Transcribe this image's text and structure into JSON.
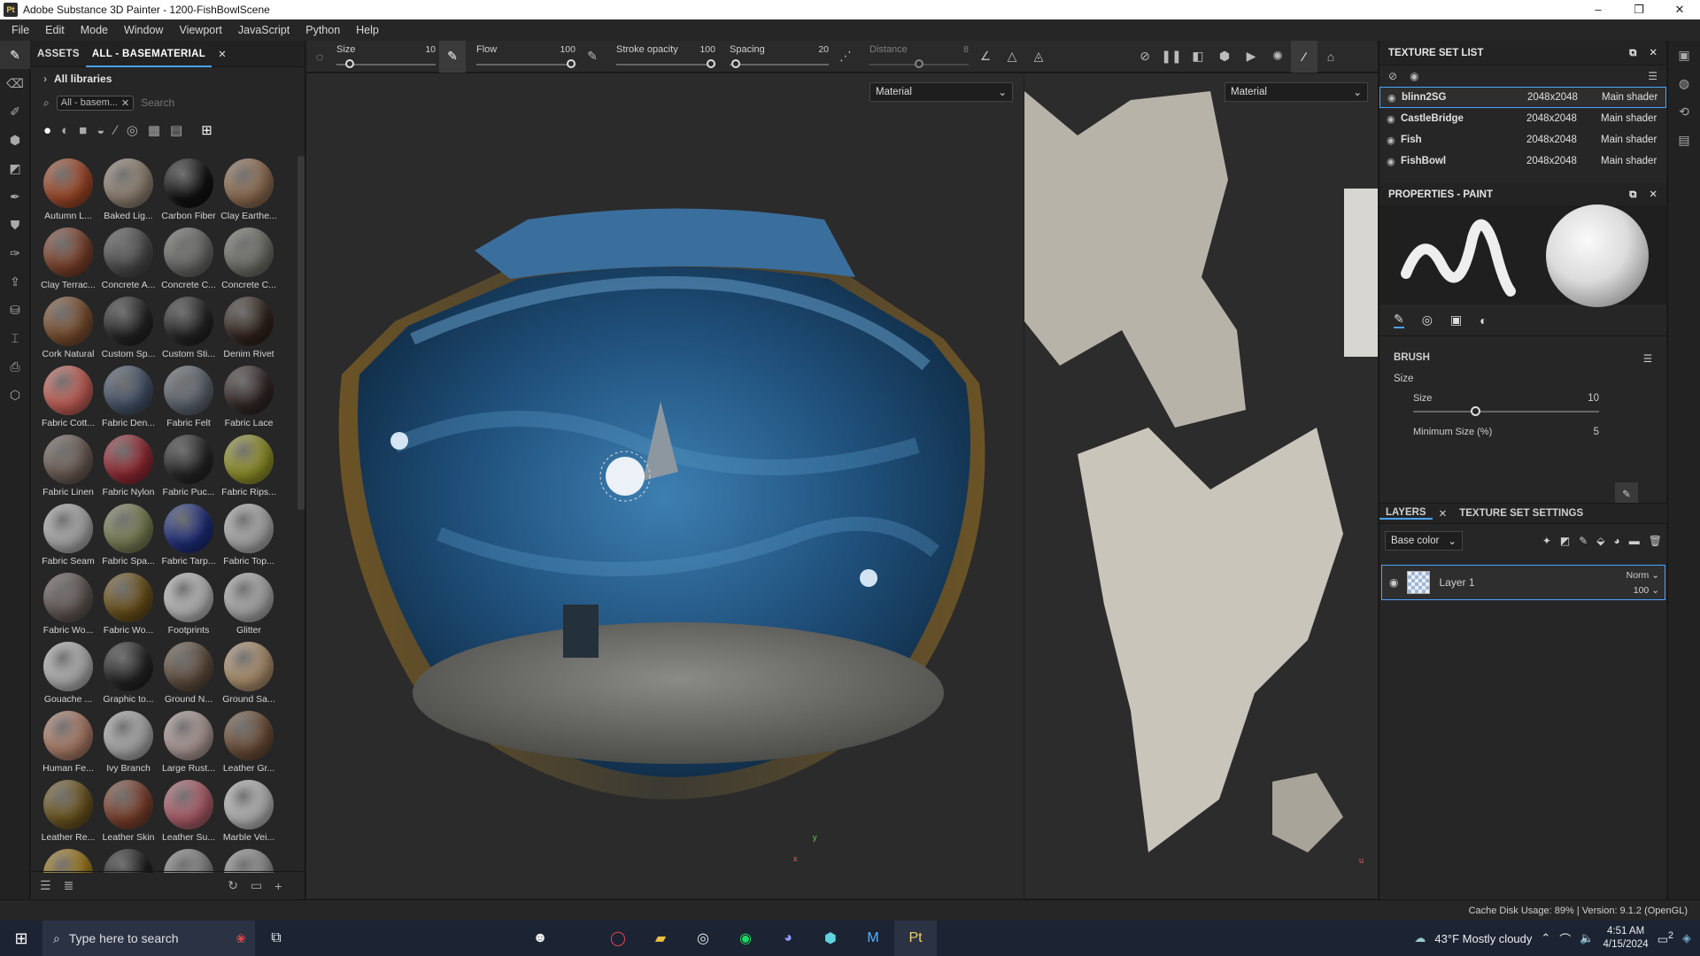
{
  "window": {
    "title": "Adobe Substance 3D Painter - 1200-FishBowlScene",
    "app_icon": "Pt",
    "minimize": "–",
    "maximize": "❐",
    "close": "✕"
  },
  "menu": [
    "File",
    "Edit",
    "Mode",
    "Window",
    "Viewport",
    "JavaScript",
    "Python",
    "Help"
  ],
  "assets": {
    "tab_assets": "ASSETS",
    "tab_filter": "ALL - BASEMATERIAL",
    "library": "All libraries",
    "chip": "All - basem...",
    "search_placeholder": "Search",
    "materials": [
      {
        "label": "Autumn L...",
        "color": "#b8532e"
      },
      {
        "label": "Baked Lig...",
        "color": "#a79683"
      },
      {
        "label": "Carbon Fiber",
        "color": "#151515"
      },
      {
        "label": "Clay Earthe...",
        "color": "#a57e5e"
      },
      {
        "label": "Clay Terrac...",
        "color": "#8f4b31"
      },
      {
        "label": "Concrete A...",
        "color": "#585858"
      },
      {
        "label": "Concrete C...",
        "color": "#7a7a78"
      },
      {
        "label": "Concrete C...",
        "color": "#828279"
      },
      {
        "label": "Cork Natural",
        "color": "#8c5a35"
      },
      {
        "label": "Custom Sp...",
        "color": "#2a2a2a"
      },
      {
        "label": "Custom Sti...",
        "color": "#2a2a2a"
      },
      {
        "label": "Denim Rivet",
        "color": "#3a2a22"
      },
      {
        "label": "Fabric Cott...",
        "color": "#e36e64"
      },
      {
        "label": "Fabric Den...",
        "color": "#4f5f78"
      },
      {
        "label": "Fabric Felt",
        "color": "#6c7480"
      },
      {
        "label": "Fabric Lace",
        "color": "#3a2c2c"
      },
      {
        "label": "Fabric Linen",
        "color": "#7d6b62"
      },
      {
        "label": "Fabric Nylon",
        "color": "#a8303b"
      },
      {
        "label": "Fabric Puc...",
        "color": "#2c2c2c"
      },
      {
        "label": "Fabric Rips...",
        "color": "#a8a830"
      },
      {
        "label": "Fabric Seam",
        "color": "#c8c8c8"
      },
      {
        "label": "Fabric Spa...",
        "color": "#8c9260"
      },
      {
        "label": "Fabric Tarp...",
        "color": "#23348a"
      },
      {
        "label": "Fabric Top...",
        "color": "#c9c9c9"
      },
      {
        "label": "Fabric Wo...",
        "color": "#6f6460"
      },
      {
        "label": "Fabric Wo...",
        "color": "#7a5c1e"
      },
      {
        "label": "Footprints",
        "color": "#d8d8d8"
      },
      {
        "label": "Glitter",
        "color": "#c8c8c8"
      },
      {
        "label": "Gouache ...",
        "color": "#d0d0d0"
      },
      {
        "label": "Graphic to...",
        "color": "#2a2a2a"
      },
      {
        "label": "Ground N...",
        "color": "#6e5a48"
      },
      {
        "label": "Ground Sa...",
        "color": "#c9a77e"
      },
      {
        "label": "Human Fe...",
        "color": "#c79079"
      },
      {
        "label": "Ivy Branch",
        "color": "#c8c8c8"
      },
      {
        "label": "Large Rust...",
        "color": "#c8b2ae"
      },
      {
        "label": "Leather Gr...",
        "color": "#7d5a40"
      },
      {
        "label": "Leather Re...",
        "color": "#7d6224"
      },
      {
        "label": "Leather Skin",
        "color": "#8e4a34"
      },
      {
        "label": "Leather Su...",
        "color": "#c86c7a"
      },
      {
        "label": "Marble Vei...",
        "color": "#d6d6d6"
      },
      {
        "label": "",
        "color": "#b58a1e"
      },
      {
        "label": "",
        "color": "#222222"
      },
      {
        "label": "",
        "color": "#9a9a9a"
      },
      {
        "label": "",
        "color": "#a8a8a8"
      }
    ]
  },
  "toolbar": {
    "size": {
      "label": "Size",
      "value": "10",
      "fill": 0.1
    },
    "flow": {
      "label": "Flow",
      "value": "100",
      "fill": 1.0
    },
    "stroke_opacity": {
      "label": "Stroke opacity",
      "value": "100",
      "fill": 1.0
    },
    "spacing": {
      "label": "Spacing",
      "value": "20",
      "fill": 0.02
    },
    "distance": {
      "label": "Distance",
      "value": "8",
      "fill": 0.5
    }
  },
  "viewport": {
    "left_mode": "Material",
    "right_mode": "Material",
    "axis_x": "x",
    "axis_y": "y",
    "uv_u": "u"
  },
  "texture_set_list": {
    "title": "TEXTURE SET LIST",
    "rows": [
      {
        "name": "blinn2SG",
        "res": "2048x2048",
        "shader": "Main shader",
        "selected": true
      },
      {
        "name": "CastleBridge",
        "res": "2048x2048",
        "shader": "Main shader",
        "selected": false
      },
      {
        "name": "Fish",
        "res": "2048x2048",
        "shader": "Main shader",
        "selected": false
      },
      {
        "name": "FishBowl",
        "res": "2048x2048",
        "shader": "Main shader",
        "selected": false
      }
    ]
  },
  "properties": {
    "title": "PROPERTIES - PAINT",
    "brush_header": "BRUSH",
    "size_group": "Size",
    "size_label": "Size",
    "size_value": "10",
    "min_size_label": "Minimum Size (%)",
    "min_size_value": "5"
  },
  "layers": {
    "tab_layers": "LAYERS",
    "tab_tss": "TEXTURE SET SETTINGS",
    "channel": "Base color",
    "layer_name": "Layer 1",
    "blend": "Norm",
    "opacity": "100"
  },
  "status": {
    "text": "Cache Disk Usage:  89% | Version: 9.1.2 (OpenGL)"
  },
  "taskbar": {
    "search_placeholder": "Type here to search",
    "weather": "43°F  Mostly cloudy",
    "time": "4:51 AM",
    "date": "4/15/2024",
    "notif_count": "2"
  }
}
